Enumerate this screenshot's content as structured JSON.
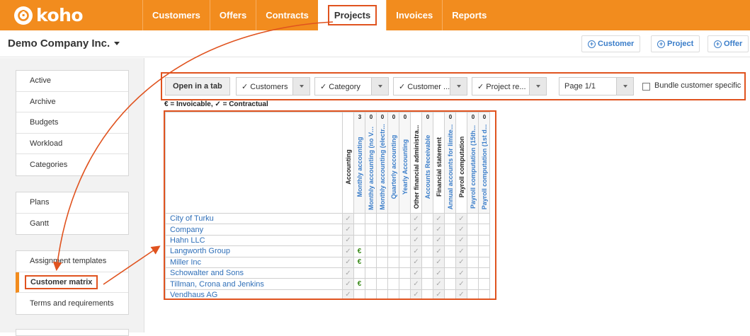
{
  "brand": {
    "name": "koho",
    "logo_icon": "koho-logo-icon"
  },
  "nav": {
    "items": [
      {
        "label": "Customers",
        "active": false
      },
      {
        "label": "Offers",
        "active": false
      },
      {
        "label": "Contracts",
        "active": false
      },
      {
        "label": "Projects",
        "active": true
      },
      {
        "label": "Invoices",
        "active": false
      },
      {
        "label": "Reports",
        "active": false
      }
    ]
  },
  "header": {
    "company": "Demo Company Inc.",
    "buttons": [
      "Customer",
      "Project",
      "Offer"
    ]
  },
  "sidebar": {
    "group1": [
      "Active",
      "Archive",
      "Budgets",
      "Workload",
      "Categories"
    ],
    "group2": [
      "Plans",
      "Gantt"
    ],
    "group3": [
      "Assignment templates",
      "Customer matrix",
      "Terms and requirements"
    ],
    "active_item": "Customer matrix"
  },
  "toolbar": {
    "open_tab": "Open in a tab",
    "filters": [
      "✓ Customers",
      "✓ Category",
      "✓ Customer ...",
      "✓ Project re..."
    ],
    "page": "Page 1/1",
    "bundle_label": "Bundle customer specific",
    "bundle_checked": false
  },
  "legend": "€ = Invoicable, ✓ = Contractual",
  "matrix": {
    "columns": [
      {
        "label": "Accounting",
        "count": "",
        "group": true
      },
      {
        "label": "Monthly accounting",
        "count": "3",
        "group": false
      },
      {
        "label": "Monthly accounting (no VAT...",
        "count": "0",
        "group": false
      },
      {
        "label": "Monthly accounting (electr...",
        "count": "0",
        "group": false
      },
      {
        "label": "Quarterly accounting",
        "count": "0",
        "group": false
      },
      {
        "label": "Yearly Accounting",
        "count": "0",
        "group": false
      },
      {
        "label": "Other financial administra...",
        "count": "",
        "group": true
      },
      {
        "label": "Accounts Receivable",
        "count": "0",
        "group": false
      },
      {
        "label": "Financial statement",
        "count": "",
        "group": true
      },
      {
        "label": "Annual accounts for limite...",
        "count": "0",
        "group": false
      },
      {
        "label": "Payroll computation",
        "count": "",
        "group": true
      },
      {
        "label": "Payroll computation (15th...",
        "count": "0",
        "group": false
      },
      {
        "label": "Payroll computation (1st d...",
        "count": "0",
        "group": false
      }
    ],
    "rows": [
      {
        "name": "City of Turku",
        "cells": [
          "✓",
          "",
          "",
          "",
          "",
          "",
          "✓",
          "",
          "✓",
          "",
          "✓",
          "",
          ""
        ]
      },
      {
        "name": "Company",
        "cells": [
          "✓",
          "",
          "",
          "",
          "",
          "",
          "✓",
          "",
          "✓",
          "",
          "✓",
          "",
          ""
        ]
      },
      {
        "name": "Hahn LLC",
        "cells": [
          "✓",
          "",
          "",
          "",
          "",
          "",
          "✓",
          "",
          "✓",
          "",
          "✓",
          "",
          ""
        ]
      },
      {
        "name": "Langworth Group",
        "cells": [
          "✓",
          "€",
          "",
          "",
          "",
          "",
          "✓",
          "",
          "✓",
          "",
          "✓",
          "",
          ""
        ]
      },
      {
        "name": "Miller Inc",
        "cells": [
          "✓",
          "€",
          "",
          "",
          "",
          "",
          "✓",
          "",
          "✓",
          "",
          "✓",
          "",
          ""
        ]
      },
      {
        "name": "Schowalter and Sons",
        "cells": [
          "✓",
          "",
          "",
          "",
          "",
          "",
          "✓",
          "",
          "✓",
          "",
          "✓",
          "",
          ""
        ]
      },
      {
        "name": "Tillman, Crona and Jenkins",
        "cells": [
          "✓",
          "€",
          "",
          "",
          "",
          "",
          "✓",
          "",
          "✓",
          "",
          "✓",
          "",
          ""
        ]
      },
      {
        "name": "Vendhaus AG",
        "cells": [
          "✓",
          "",
          "",
          "",
          "",
          "",
          "✓",
          "",
          "✓",
          "",
          "✓",
          "",
          ""
        ]
      }
    ]
  },
  "colors": {
    "brand_orange": "#f28c1e",
    "highlight_red": "#e0531f",
    "link_blue": "#2f6fb8",
    "euro_green": "#3a8a1a"
  }
}
